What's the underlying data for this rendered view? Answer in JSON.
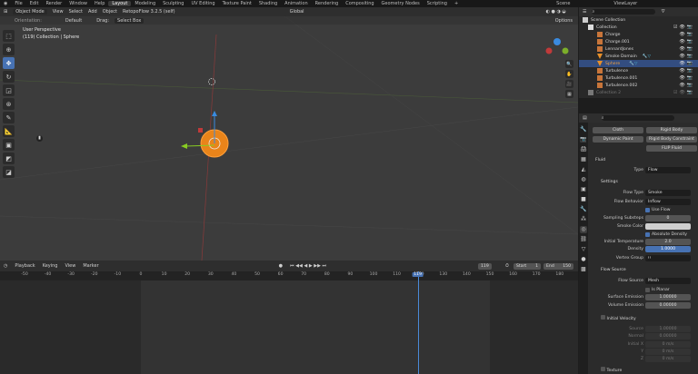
{
  "menu": [
    "File",
    "Edit",
    "Render",
    "Window",
    "Help"
  ],
  "workspaces": [
    "Layout",
    "Modeling",
    "Sculpting",
    "UV Editing",
    "Texture Paint",
    "Shading",
    "Animation",
    "Rendering",
    "Compositing",
    "Geometry Nodes",
    "Scripting",
    "+"
  ],
  "active_workspace": "Layout",
  "scene": "Scene",
  "view_layer": "ViewLayer",
  "viewport": {
    "header": {
      "mode": "Object Mode",
      "menus": [
        "View",
        "Select",
        "Add",
        "Object"
      ],
      "addon": "RetopoFlow 3.2.5 (self)",
      "transform": "Global",
      "options": "Options"
    },
    "toolhdr": {
      "orientation_label": "Orientation:",
      "orientation": "Default",
      "drag_label": "Drag:",
      "drag": "Select Box"
    },
    "info": {
      "view": "User Perspective",
      "object": "(119) Collection | Sphere"
    },
    "tools": [
      "select-box",
      "cursor",
      "move",
      "rotate",
      "scale",
      "transform",
      "annotate",
      "measure",
      "add-cube",
      "extrude",
      "shrink"
    ]
  },
  "outliner": {
    "search_placeholder": "",
    "root": "Scene Collection",
    "items": [
      {
        "name": "Collection",
        "type": "collection"
      },
      {
        "name": "Charge",
        "type": "object"
      },
      {
        "name": "Charge.001",
        "type": "object"
      },
      {
        "name": "LennardJones",
        "type": "object"
      },
      {
        "name": "Smoke Domain",
        "type": "mesh"
      },
      {
        "name": "Sphere",
        "type": "mesh",
        "selected": true
      },
      {
        "name": "Turbulence",
        "type": "object"
      },
      {
        "name": "Turbulence.001",
        "type": "object"
      },
      {
        "name": "Turbulence.002",
        "type": "object"
      },
      {
        "name": "Collection 2",
        "type": "collection",
        "disabled": true
      }
    ]
  },
  "properties": {
    "physics_buttons": [
      "Cloth",
      "Dynamic Paint",
      "Rigid Body",
      "Rigid Body Constraint",
      "FLIP Fluid"
    ],
    "fluid_panel": "Fluid",
    "type_label": "Type",
    "type": "Flow",
    "settings_panel": "Settings",
    "flow_type_label": "Flow Type",
    "flow_type": "Smoke",
    "flow_behavior_label": "Flow Behavior",
    "flow_behavior": "Inflow",
    "use_flow": "Use Flow",
    "sampling_label": "Sampling Substeps",
    "sampling": "0",
    "smoke_color_label": "Smoke Color",
    "smoke_color": "#cfcfcf",
    "absolute_density": "Absolute Density",
    "initial_temp_label": "Initial Temperature",
    "initial_temp": "2.0",
    "density_label": "Density",
    "density": "1.0000",
    "vertex_group_label": "Vertex Group",
    "flow_source_panel": "Flow Source",
    "flow_source_label": "Flow Source",
    "flow_source": "Mesh",
    "is_planar": "Is Planar",
    "surface_emission_label": "Surface Emission",
    "surface_emission": "1.00000",
    "volume_emission_label": "Volume Emission",
    "volume_emission": "0.00000",
    "initial_velocity_panel": "Initial Velocity",
    "source_label": "Source",
    "source": "1.00000",
    "normal_label": "Normal",
    "normal": "0.00000",
    "initial_x_label": "Initial X",
    "initial_x": "0 m/s",
    "y_label": "Y",
    "y": "0 m/s",
    "z_label": "Z",
    "z": "0 m/s",
    "texture_panel": "Texture"
  },
  "timeline": {
    "menus": [
      "Playback",
      "Keying",
      "View",
      "Marker"
    ],
    "current_frame": "119",
    "start_label": "Start",
    "start": "1",
    "end_label": "End",
    "end": "150",
    "ticks": [
      -50,
      -40,
      -30,
      -20,
      -10,
      0,
      10,
      20,
      30,
      40,
      50,
      60,
      70,
      80,
      90,
      100,
      110,
      120,
      130,
      140,
      150,
      160,
      170,
      180
    ]
  },
  "colors": {
    "accent": "#4772b3",
    "selected_object": "#f08a1a"
  }
}
